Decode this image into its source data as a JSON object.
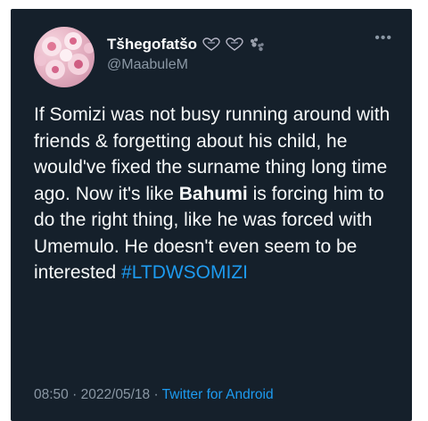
{
  "user": {
    "display_name": "Tšhegofatšo",
    "handle": "@MaabuleM"
  },
  "tweet": {
    "text_before": "If Somizi was not busy running around with friends & forgetting about his child, he would've fixed the surname thing long time ago. Now it's like ",
    "bold_mention": "Bahumi",
    "text_after": " is forcing him to do the right thing, like he was forced with Umemulo. He doesn't even seem to be interested ",
    "hashtag": "#LTDWSOMIZI"
  },
  "meta": {
    "time": "08:50",
    "date": "2022/05/18",
    "separator": " · ",
    "source": "Twitter for Android"
  },
  "icons": {
    "more": "more-options-icon",
    "emoji1": "heart-ribbon-icon",
    "emoji2": "heart-ribbon-icon",
    "emoji3": "paw-prints-icon"
  },
  "colors": {
    "background": "#15202b",
    "text": "#f7f9f9",
    "secondary": "#8b98a5",
    "accent": "#1d9bf0"
  }
}
